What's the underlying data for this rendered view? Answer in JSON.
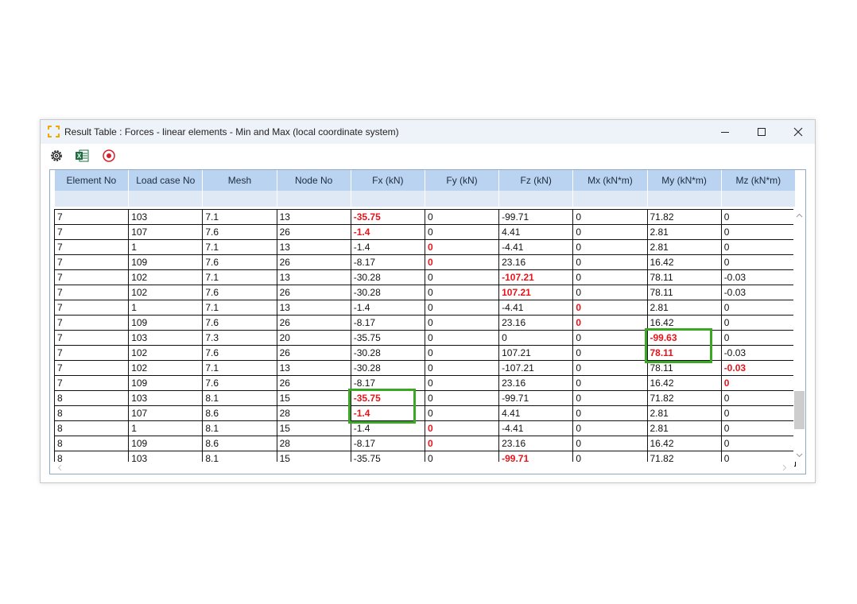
{
  "window": {
    "title": "Result Table : Forces - linear elements - Min and Max (local coordinate system)"
  },
  "icons": {
    "app": "result-table-bracket-icon",
    "settings": "gear-icon",
    "excel": "excel-export-icon",
    "record": "target-record-icon",
    "excel_letter": "X"
  },
  "colors": {
    "header_bg": "#b9d3f0",
    "filter_bg": "#dfe9f5",
    "extreme_value": "#e8141b",
    "highlight_box": "#3aa822"
  },
  "table": {
    "columns": [
      "Element No",
      "Load case No",
      "Mesh",
      "Node No",
      "Fx (kN)",
      "Fy (kN)",
      "Fz (kN)",
      "Mx (kN*m)",
      "My (kN*m)",
      "Mz (kN*m)"
    ],
    "rows": [
      {
        "cells": [
          "7",
          "103",
          "7.1",
          "13",
          "-35.75",
          "0",
          "-99.71",
          "0",
          "71.82",
          "0"
        ],
        "red": [
          4
        ]
      },
      {
        "cells": [
          "7",
          "107",
          "7.6",
          "26",
          "-1.4",
          "0",
          "4.41",
          "0",
          "2.81",
          "0"
        ],
        "red": [
          4
        ]
      },
      {
        "cells": [
          "7",
          "1",
          "7.1",
          "13",
          "-1.4",
          "0",
          "-4.41",
          "0",
          "2.81",
          "0"
        ],
        "red": [
          5
        ]
      },
      {
        "cells": [
          "7",
          "109",
          "7.6",
          "26",
          "-8.17",
          "0",
          "23.16",
          "0",
          "16.42",
          "0"
        ],
        "red": [
          5
        ]
      },
      {
        "cells": [
          "7",
          "102",
          "7.1",
          "13",
          "-30.28",
          "0",
          "-107.21",
          "0",
          "78.11",
          "-0.03"
        ],
        "red": [
          6
        ]
      },
      {
        "cells": [
          "7",
          "102",
          "7.6",
          "26",
          "-30.28",
          "0",
          "107.21",
          "0",
          "78.11",
          "-0.03"
        ],
        "red": [
          6
        ]
      },
      {
        "cells": [
          "7",
          "1",
          "7.1",
          "13",
          "-1.4",
          "0",
          "-4.41",
          "0",
          "2.81",
          "0"
        ],
        "red": [
          7
        ]
      },
      {
        "cells": [
          "7",
          "109",
          "7.6",
          "26",
          "-8.17",
          "0",
          "23.16",
          "0",
          "16.42",
          "0"
        ],
        "red": [
          7
        ]
      },
      {
        "cells": [
          "7",
          "103",
          "7.3",
          "20",
          "-35.75",
          "0",
          "0",
          "0",
          "-99.63",
          "0"
        ],
        "red": [
          8
        ]
      },
      {
        "cells": [
          "7",
          "102",
          "7.6",
          "26",
          "-30.28",
          "0",
          "107.21",
          "0",
          "78.11",
          "-0.03"
        ],
        "red": [
          8
        ]
      },
      {
        "cells": [
          "7",
          "102",
          "7.1",
          "13",
          "-30.28",
          "0",
          "-107.21",
          "0",
          "78.11",
          "-0.03"
        ],
        "red": [
          9
        ]
      },
      {
        "cells": [
          "7",
          "109",
          "7.6",
          "26",
          "-8.17",
          "0",
          "23.16",
          "0",
          "16.42",
          "0"
        ],
        "red": [
          9
        ]
      },
      {
        "cells": [
          "8",
          "103",
          "8.1",
          "15",
          "-35.75",
          "0",
          "-99.71",
          "0",
          "71.82",
          "0"
        ],
        "red": [
          4
        ]
      },
      {
        "cells": [
          "8",
          "107",
          "8.6",
          "28",
          "-1.4",
          "0",
          "4.41",
          "0",
          "2.81",
          "0"
        ],
        "red": [
          4
        ]
      },
      {
        "cells": [
          "8",
          "1",
          "8.1",
          "15",
          "-1.4",
          "0",
          "-4.41",
          "0",
          "2.81",
          "0"
        ],
        "red": [
          5
        ]
      },
      {
        "cells": [
          "8",
          "109",
          "8.6",
          "28",
          "-8.17",
          "0",
          "23.16",
          "0",
          "16.42",
          "0"
        ],
        "red": [
          5
        ]
      },
      {
        "cells": [
          "8",
          "103",
          "8.1",
          "15",
          "-35.75",
          "0",
          "-99.71",
          "0",
          "71.82",
          "0"
        ],
        "red": [
          6
        ]
      }
    ]
  },
  "highlights": [
    {
      "name": "highlight-my-extremes",
      "rows": [
        8,
        9
      ],
      "col": 8
    },
    {
      "name": "highlight-fx-extremes",
      "rows": [
        12,
        13
      ],
      "col": 4
    }
  ]
}
